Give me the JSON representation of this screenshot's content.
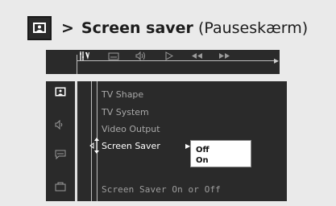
{
  "header": {
    "arrow": ">",
    "title": "Screen saver",
    "subtitle": "(Pauseskærm)",
    "icon": "screen-icon"
  },
  "topbar": {
    "icons": [
      "settings-icon",
      "subtitle-icon",
      "audio-icon",
      "play-icon",
      "rewind-icon",
      "fast-forward-icon"
    ]
  },
  "sidebar": {
    "icons": [
      "screen-icon",
      "speaker-icon",
      "chat-icon",
      "folder-icon"
    ]
  },
  "menu": {
    "items": [
      {
        "label": "TV Shape"
      },
      {
        "label": "TV System"
      },
      {
        "label": "Video Output"
      },
      {
        "label": "Screen Saver"
      }
    ],
    "footer": "Screen Saver On or Off"
  },
  "dropdown": {
    "options": [
      "Off",
      "On"
    ],
    "selected": "Off"
  }
}
